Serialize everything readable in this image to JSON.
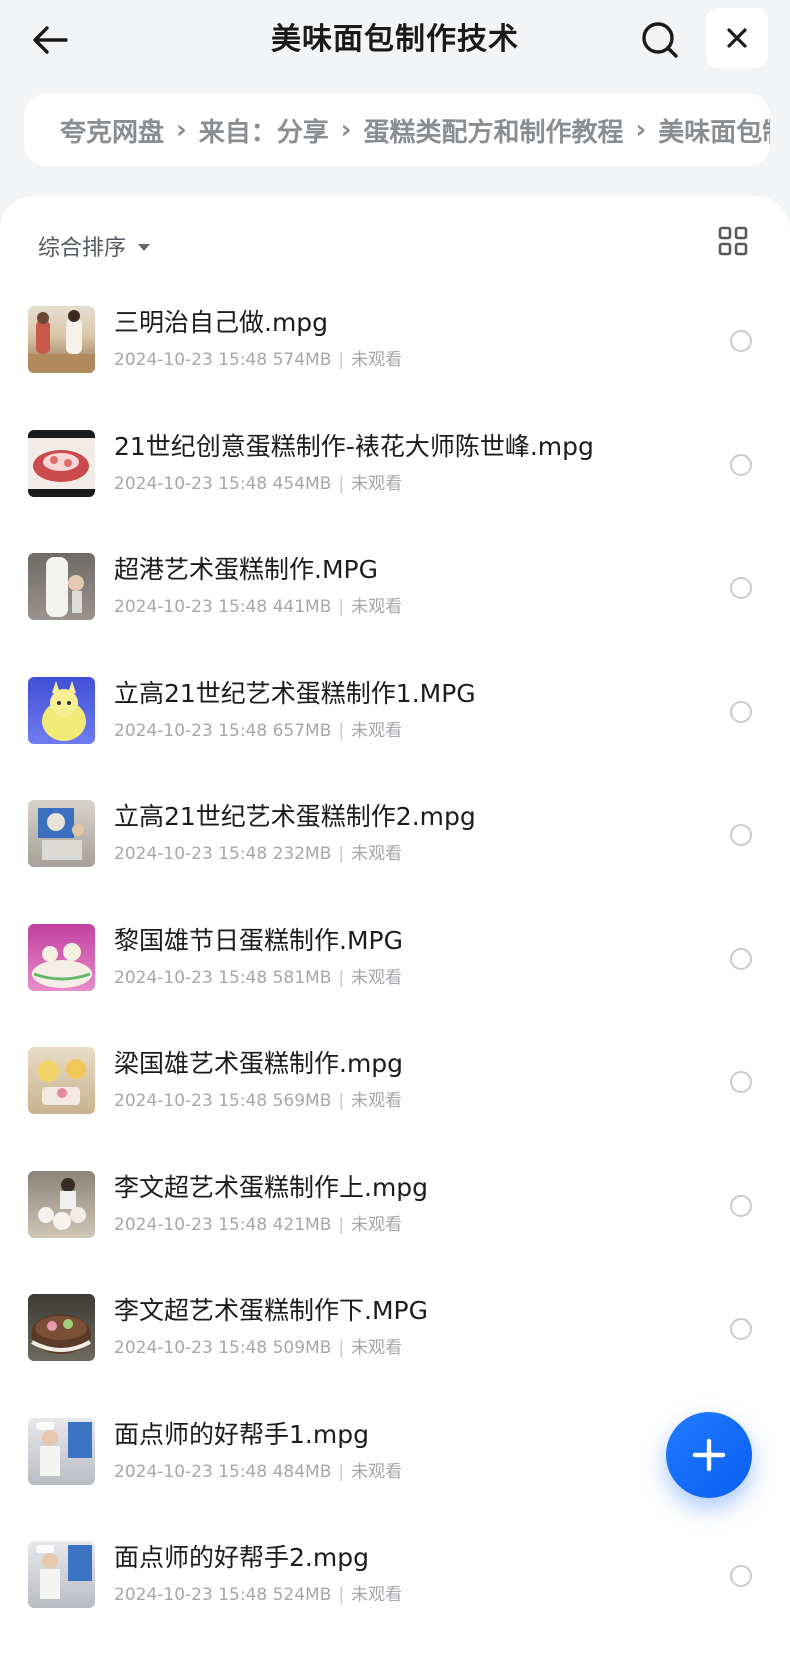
{
  "header": {
    "title": "美味面包制作技术",
    "icons": {
      "back": "arrow-left-icon",
      "search": "search-icon",
      "close": "close-icon"
    }
  },
  "breadcrumb": [
    "夸克网盘",
    "来自：分享",
    "蛋糕类配方和制作教程",
    "美味面包制作技术"
  ],
  "toolbar": {
    "sort_label": "综合排序",
    "view_icon": "grid-view-icon"
  },
  "files": [
    {
      "name": "三明治自己做.mpg",
      "date": "2024-10-23 15:48",
      "size": "574MB",
      "status": "未观看"
    },
    {
      "name": "21世纪创意蛋糕制作-裱花大师陈世峰.mpg",
      "date": "2024-10-23 15:48",
      "size": "454MB",
      "status": "未观看"
    },
    {
      "name": "超港艺术蛋糕制作.MPG",
      "date": "2024-10-23 15:48",
      "size": "441MB",
      "status": "未观看"
    },
    {
      "name": "立高21世纪艺术蛋糕制作1.MPG",
      "date": "2024-10-23 15:48",
      "size": "657MB",
      "status": "未观看"
    },
    {
      "name": "立高21世纪艺术蛋糕制作2.mpg",
      "date": "2024-10-23 15:48",
      "size": "232MB",
      "status": "未观看"
    },
    {
      "name": "黎国雄节日蛋糕制作.MPG",
      "date": "2024-10-23 15:48",
      "size": "581MB",
      "status": "未观看"
    },
    {
      "name": "梁国雄艺术蛋糕制作.mpg",
      "date": "2024-10-23 15:48",
      "size": "569MB",
      "status": "未观看"
    },
    {
      "name": "李文超艺术蛋糕制作上.mpg",
      "date": "2024-10-23 15:48",
      "size": "421MB",
      "status": "未观看"
    },
    {
      "name": "李文超艺术蛋糕制作下.MPG",
      "date": "2024-10-23 15:48",
      "size": "509MB",
      "status": "未观看"
    },
    {
      "name": "面点师的好帮手1.mpg",
      "date": "2024-10-23 15:48",
      "size": "484MB",
      "status": "未观看"
    },
    {
      "name": "面点师的好帮手2.mpg",
      "date": "2024-10-23 15:48",
      "size": "524MB",
      "status": "未观看"
    }
  ],
  "fab": {
    "icon": "plus-icon"
  },
  "colors": {
    "accent": "#1f7bff",
    "background": "#f3f4f6",
    "panel": "#ffffff"
  }
}
